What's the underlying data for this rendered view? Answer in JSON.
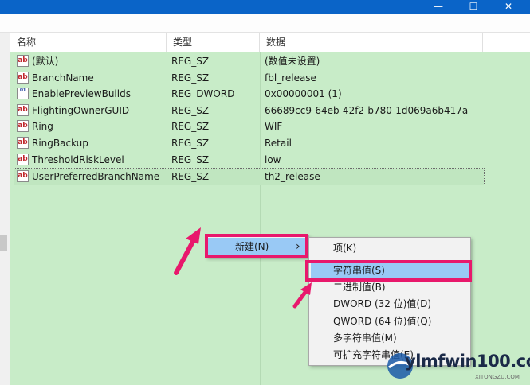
{
  "window": {
    "minimize": "—",
    "maximize": "☐",
    "close": "✕"
  },
  "list": {
    "headers": {
      "name": "名称",
      "type": "类型",
      "data": "数据"
    },
    "rows": [
      {
        "icon": "ab",
        "name": "(默认)",
        "type": "REG_SZ",
        "data": "(数值未设置)"
      },
      {
        "icon": "ab",
        "name": "BranchName",
        "type": "REG_SZ",
        "data": "fbl_release"
      },
      {
        "icon": "01",
        "name": "EnablePreviewBuilds",
        "type": "REG_DWORD",
        "data": "0x00000001 (1)"
      },
      {
        "icon": "ab",
        "name": "FlightingOwnerGUID",
        "type": "REG_SZ",
        "data": "66689cc9-64eb-42f2-b780-1d069a6b417a"
      },
      {
        "icon": "ab",
        "name": "Ring",
        "type": "REG_SZ",
        "data": "WIF"
      },
      {
        "icon": "ab",
        "name": "RingBackup",
        "type": "REG_SZ",
        "data": "Retail"
      },
      {
        "icon": "ab",
        "name": "ThresholdRiskLevel",
        "type": "REG_SZ",
        "data": "low"
      },
      {
        "icon": "ab",
        "name": "UserPreferredBranchName",
        "type": "REG_SZ",
        "data": "th2_release"
      }
    ]
  },
  "context_menu": {
    "new_label": "新建(N)",
    "submenu_arrow": "›"
  },
  "submenu": {
    "items": [
      "项(K)",
      "字符串值(S)",
      "二进制值(B)",
      "DWORD (32 位)值(D)",
      "QWORD (64 位)值(Q)",
      "多字符串值(M)",
      "可扩充字符串值(E)"
    ]
  },
  "watermark": {
    "text": "ylmfwin100.com",
    "sub": "XITONGZU.COM"
  },
  "colors": {
    "list_bg": "#c8ecc8",
    "highlight": "#e8186c",
    "menu_hover": "#99c9f5",
    "titlebar": "#0a64c8"
  }
}
